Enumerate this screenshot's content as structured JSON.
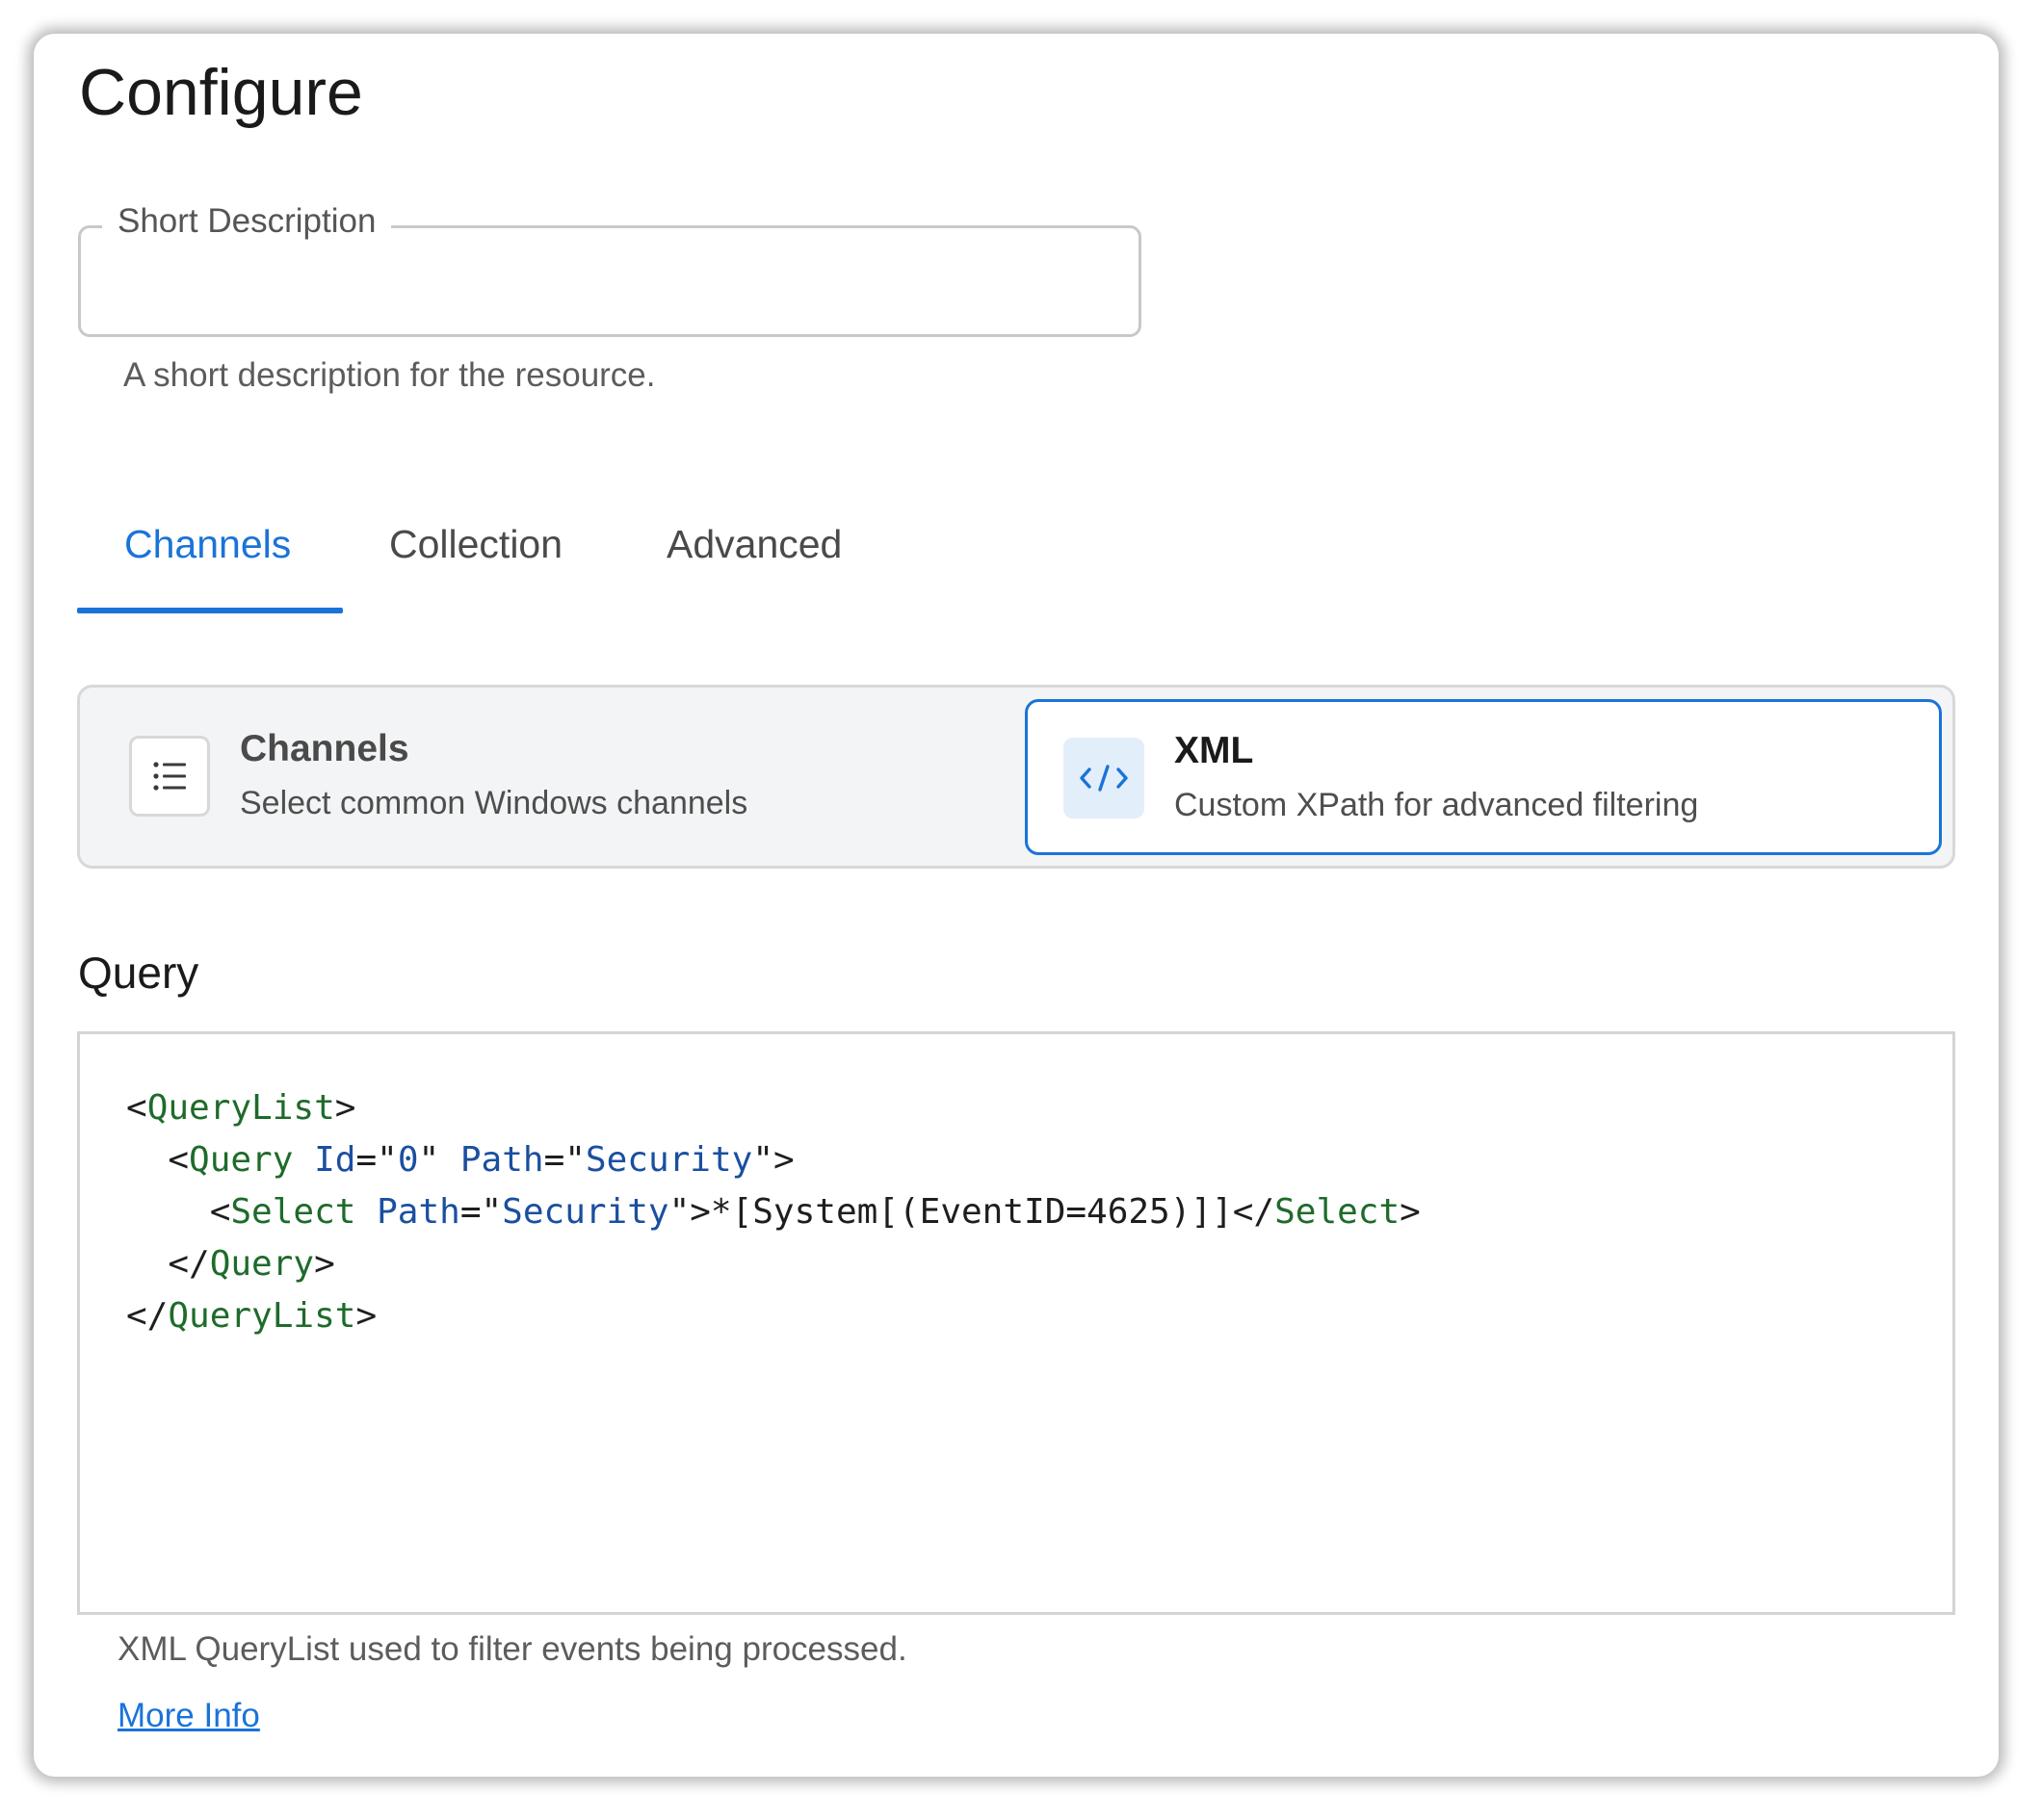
{
  "page": {
    "title": "Configure"
  },
  "short_description": {
    "label": "Short Description",
    "value": "",
    "helper": "A short description for the resource."
  },
  "tabs": [
    {
      "label": "Channels",
      "active": true
    },
    {
      "label": "Collection",
      "active": false
    },
    {
      "label": "Advanced",
      "active": false
    }
  ],
  "mode_selector": {
    "options": [
      {
        "title": "Channels",
        "description": "Select common Windows channels",
        "icon": "list-icon",
        "selected": false
      },
      {
        "title": "XML",
        "description": "Custom XPath for advanced filtering",
        "icon": "code-icon",
        "selected": true
      }
    ]
  },
  "query": {
    "label": "Query",
    "code": "<QueryList>\n  <Query Id=\"0\" Path=\"Security\">\n    <Select Path=\"Security\">*[System[(EventID=4625)]]</Select>\n  </Query>\n</QueryList>",
    "helper": "XML QueryList used to filter events being processed.",
    "link_label": "More Info"
  },
  "colors": {
    "accent": "#1a73d9",
    "xml_tag": "#1e6b2a",
    "xml_attr": "#1a4fa0"
  }
}
